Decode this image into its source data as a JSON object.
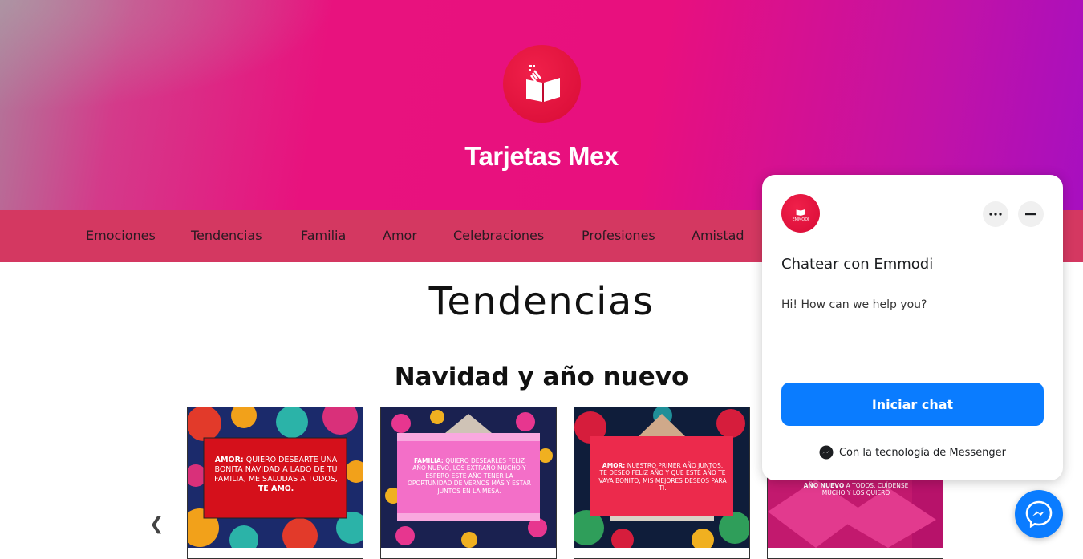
{
  "site": {
    "title": "Tarjetas Mex"
  },
  "nav": {
    "items": [
      "Emociones",
      "Tendencias",
      "Familia",
      "Amor",
      "Celebraciones",
      "Profesiones",
      "Amistad"
    ]
  },
  "main": {
    "page_title": "Tendencias",
    "section_title": "Navidad y año nuevo",
    "prev_arrow": "❮",
    "next_arrow": "❯",
    "cards": [
      {
        "bold": "Amor:",
        "text": "quiero desearte una bonita navidad a lado de tu familia, me saludas a todos,",
        "tail": "te amo."
      },
      {
        "bold": "Familia:",
        "text": "quiero desearles feliz año nuevo, los extraño mucho y espero este año tener la oportunidad de vernos más y estar juntos en la mesa.",
        "tail": ""
      },
      {
        "bold": "Amor:",
        "text": "nuestro primer año juntos, te deseo feliz año y que este año te vaya bonito, mis mejores deseos para ti.",
        "tail": ""
      },
      {
        "bold": "año nuevo",
        "text": "a todos, cuídense mucho y los quiero",
        "tail": ""
      }
    ]
  },
  "chat": {
    "avatar_text": "EMMODI",
    "title": "Chatear con Emmodi",
    "greeting": "Hi! How can we help you?",
    "button_label": "Iniciar chat",
    "powered_by": "Con la tecnología de Messenger"
  },
  "colors": {
    "nav_bg": "#d43861",
    "brand_red": "#e0103c",
    "messenger_blue": "#0a7cff"
  }
}
